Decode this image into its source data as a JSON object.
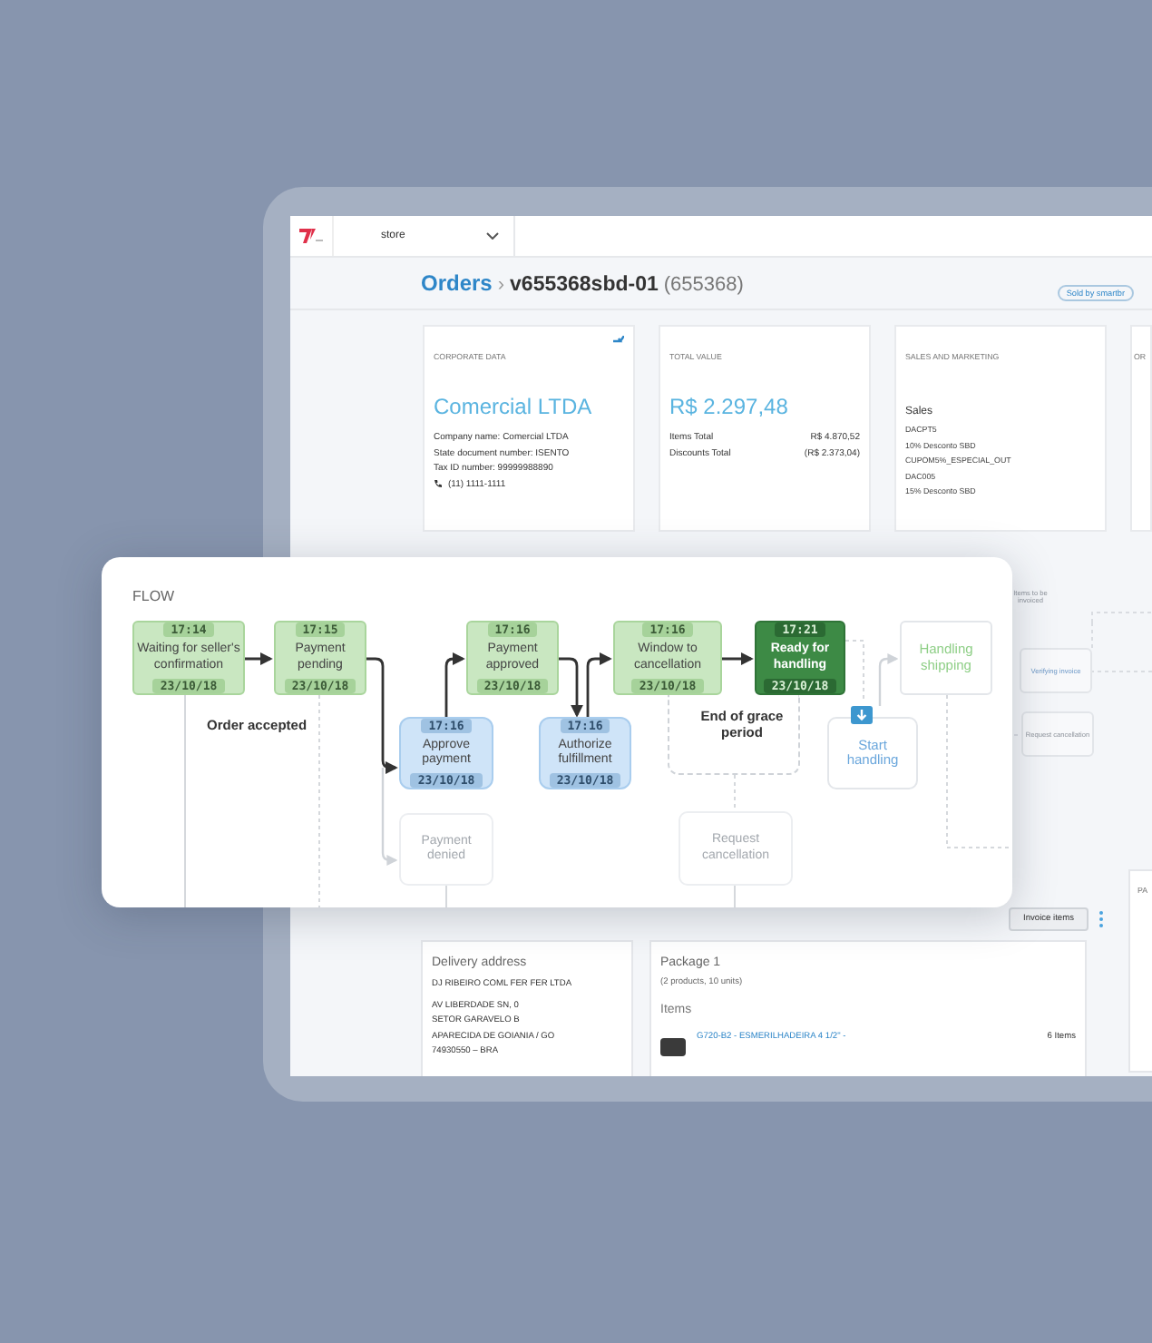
{
  "topbar": {
    "store_selector": "store"
  },
  "breadcrumb": {
    "root": "Orders",
    "separator": "›",
    "order_id": "v655368sbd-01",
    "order_number": "(655368)"
  },
  "seller_badge": "Sold by smartbr",
  "cards": [
    {
      "kind": "contact",
      "title": "CORPORATE DATA",
      "headline": "Comercial LTDA",
      "lines": [
        "Company name: Comercial LTDA",
        "State document number: ISENTO",
        "Tax ID number: 99999988890"
      ],
      "phone": "(11) 1111-1111"
    },
    {
      "kind": "totals",
      "title": "TOTAL VALUE",
      "headline": "R$ 2.297,48",
      "rows": [
        {
          "label": "Items Total",
          "value": "R$ 4.870,52"
        },
        {
          "label": "Discounts Total",
          "value": "(R$ 2.373,04)"
        }
      ]
    },
    {
      "kind": "list",
      "title": "SALES AND MARKETING",
      "heading": "Sales",
      "lines": [
        "DACPT5",
        "10% Desconto SBD",
        "CUPOM5%_ESPECIAL_OUT",
        "DAC005",
        "15% Desconto SBD"
      ]
    },
    {
      "kind": "stub",
      "title": "OR"
    }
  ],
  "background_flow": {
    "note": "Items to be invoiced",
    "nodes": [
      "Verifying invoice",
      "Request cancellation"
    ]
  },
  "flow": {
    "title": "FLOW",
    "nodes": [
      {
        "kind": "done",
        "label": "Waiting for seller's confirmation",
        "time": "17:14",
        "date": "23/10/18"
      },
      {
        "kind": "done",
        "label": "Payment pending",
        "time": "17:15",
        "date": "23/10/18"
      },
      {
        "kind": "done",
        "label": "Payment approved",
        "time": "17:16",
        "date": "23/10/18"
      },
      {
        "kind": "done",
        "label": "Window to cancellation",
        "time": "17:16",
        "date": "23/10/18"
      },
      {
        "kind": "current",
        "label": "Ready for handling",
        "time": "17:21",
        "date": "23/10/18"
      },
      {
        "kind": "next",
        "label": "Handling shipping"
      },
      {
        "kind": "action",
        "label": "Approve payment",
        "time": "17:16",
        "date": "23/10/18"
      },
      {
        "kind": "action",
        "label": "Authorize fulfillment",
        "time": "17:16",
        "date": "23/10/18"
      },
      {
        "kind": "faded",
        "label": "Payment denied"
      },
      {
        "kind": "start",
        "label": "Start handling"
      },
      {
        "kind": "faded",
        "label": "Request cancellation"
      }
    ],
    "notes": [
      "Order accepted",
      "End of grace period"
    ]
  },
  "toolbar": {
    "button": "Invoice items"
  },
  "side_heading": "PA",
  "delivery": {
    "title": "Delivery address",
    "name": "DJ RIBEIRO COML FER FER LTDA",
    "lines": [
      "AV LIBERDADE SN, 0",
      "SETOR GARAVELO B",
      "APARECIDA DE GOIANIA / GO",
      "74930550 – BRA"
    ]
  },
  "package": {
    "title": "Package 1",
    "summary": "(2 products, 10 units)",
    "items_heading": "Items",
    "items": [
      {
        "name": "G720-B2 - ESMERILHADEIRA 4 1/2\" -",
        "quantity": "6 Items"
      }
    ]
  }
}
